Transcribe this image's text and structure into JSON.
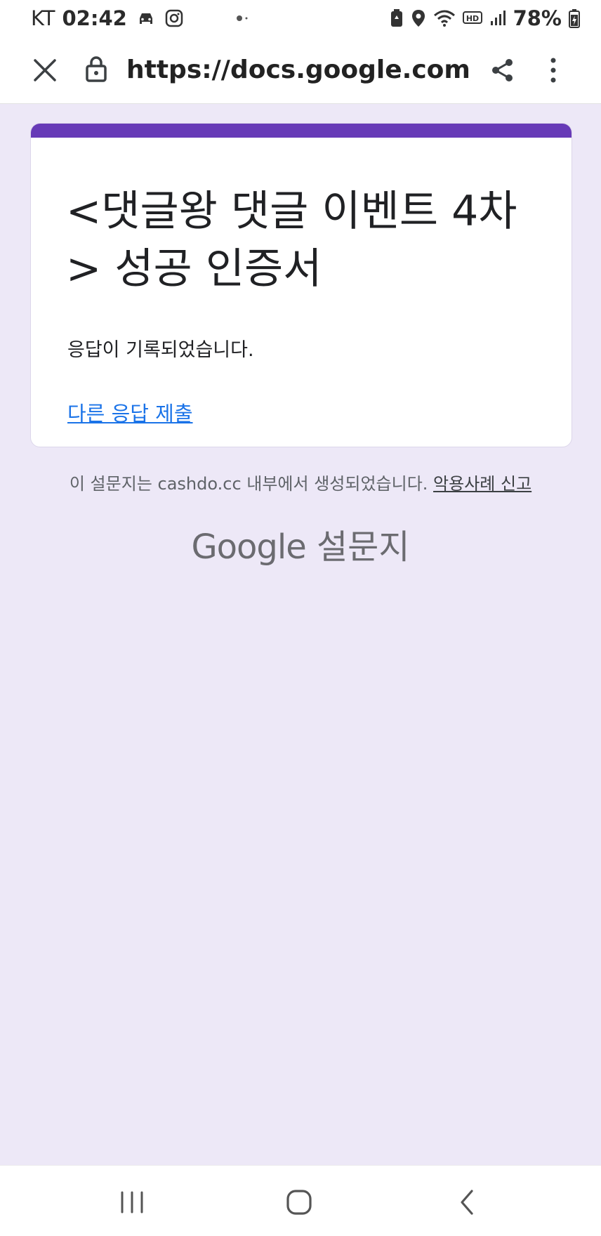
{
  "status_bar": {
    "carrier": "KT",
    "time": "02:42",
    "battery_percent": "78%",
    "icons": [
      "car-icon",
      "instagram-icon",
      "notification-dots-icon",
      "battery-saver-icon",
      "location-icon",
      "wifi-icon",
      "hd-icon",
      "signal-icon",
      "battery-charging-icon"
    ]
  },
  "url_bar": {
    "url": "https://docs.google.com/fo",
    "icons": [
      "close-icon",
      "lock-icon",
      "share-icon",
      "more-vert-icon"
    ]
  },
  "form": {
    "title": "<댓글왕 댓글 이벤트 4차> 성공 인증서",
    "message": "응답이 기록되었습니다.",
    "submit_another_link": "다른 응답 제출",
    "accent_color": "#673ab7",
    "link_color": "#1a73e8"
  },
  "footer": {
    "note": "이 설문지는 cashdo.cc 내부에서 생성되었습니다.",
    "report_abuse": "악용사례 신고",
    "brand_google": "Google",
    "brand_forms": "설문지"
  },
  "nav_bar": {
    "icons": [
      "recent-apps-icon",
      "home-icon",
      "back-icon"
    ]
  },
  "colors": {
    "page_background": "#ede8f7",
    "card_background": "#ffffff"
  }
}
